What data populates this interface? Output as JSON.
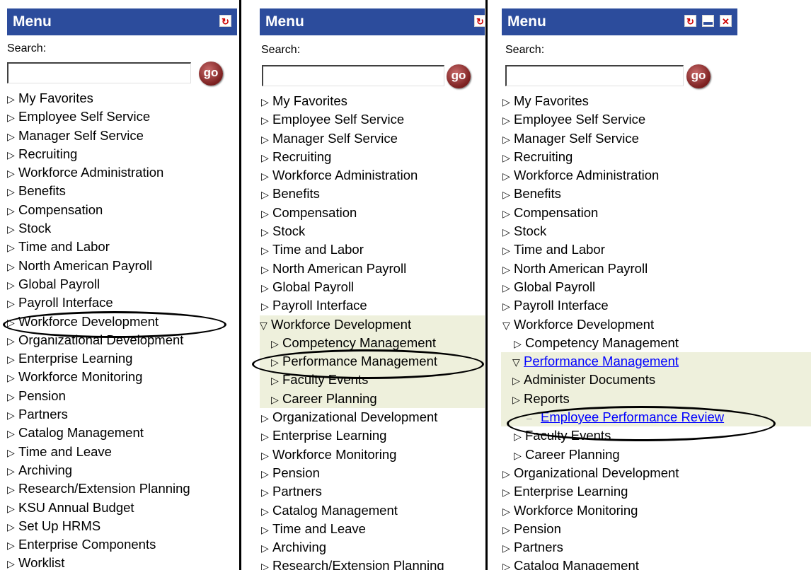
{
  "panel1": {
    "title": "Menu",
    "search_label": "Search:",
    "search_value": "",
    "go_label": "go",
    "items": [
      "My Favorites",
      "Employee Self Service",
      "Manager Self Service",
      "Recruiting",
      "Workforce Administration",
      "Benefits",
      "Compensation",
      "Stock",
      "Time and Labor",
      "North American Payroll",
      "Global Payroll",
      "Payroll Interface",
      "Workforce Development",
      "Organizational Development",
      "Enterprise Learning",
      "Workforce Monitoring",
      "Pension",
      "Partners",
      "Catalog Management",
      "Time and Leave",
      "Archiving",
      "Research/Extension Planning",
      "KSU Annual Budget",
      "Set Up HRMS",
      "Enterprise Components",
      "Worklist"
    ]
  },
  "panel2": {
    "title": "Menu",
    "search_label": "Search:",
    "search_value": "",
    "go_label": "go",
    "items": [
      "My Favorites",
      "Employee Self Service",
      "Manager Self Service",
      "Recruiting",
      "Workforce Administration",
      "Benefits",
      "Compensation",
      "Stock",
      "Time and Labor",
      "North American Payroll",
      "Global Payroll",
      "Payroll Interface"
    ],
    "expanded": "Workforce Development",
    "sub_items": [
      "Competency Management",
      "Performance Management",
      "Faculty Events",
      "Career Planning"
    ],
    "after_items": [
      "Organizational Development",
      "Enterprise Learning",
      "Workforce Monitoring",
      "Pension",
      "Partners",
      "Catalog Management",
      "Time and Leave",
      "Archiving",
      "Research/Extension Planning"
    ]
  },
  "panel3": {
    "title": "Menu",
    "search_label": "Search:",
    "search_value": "",
    "go_label": "go",
    "items": [
      "My Favorites",
      "Employee Self Service",
      "Manager Self Service",
      "Recruiting",
      "Workforce Administration",
      "Benefits",
      "Compensation",
      "Stock",
      "Time and Labor",
      "North American Payroll",
      "Global Payroll",
      "Payroll Interface"
    ],
    "expanded": "Workforce Development",
    "sub_first": "Competency Management",
    "expanded_sub": "Performance Management",
    "subsub_items": [
      "Administer Documents",
      "Reports"
    ],
    "link_item": "Employee Performance Review",
    "after_sub": [
      "Faculty Events",
      "Career Planning"
    ],
    "after_items": [
      "Organizational Development",
      "Enterprise Learning",
      "Workforce Monitoring",
      "Pension",
      "Partners",
      "Catalog Management"
    ]
  },
  "icons": {
    "refresh": "refresh-icon",
    "minimize": "minimize-icon",
    "close": "close-icon",
    "collapsed": "triangle-right-icon",
    "expanded": "triangle-down-icon"
  }
}
